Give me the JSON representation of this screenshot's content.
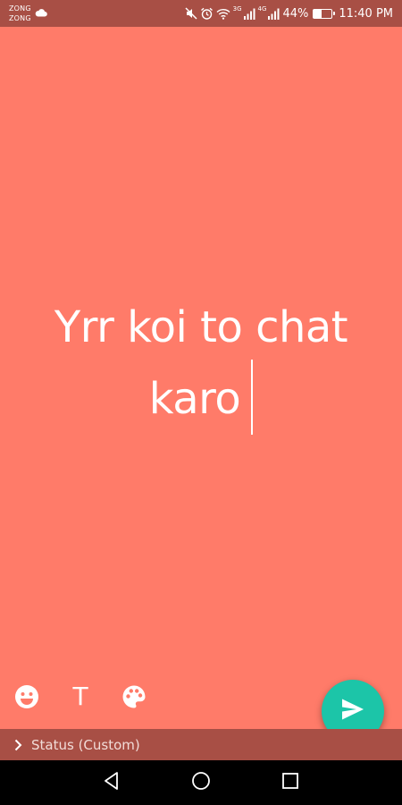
{
  "status_bar": {
    "carrier_1": "ZONG",
    "carrier_2": "ZONG",
    "network_1": "3G",
    "network_2": "4G",
    "battery_percent": "44%",
    "battery_level": 0.44,
    "time": "11:40 PM",
    "icons": [
      "cloud-icon",
      "mute-icon",
      "alarm-icon",
      "wifi-icon",
      "signal-icon",
      "battery-icon"
    ]
  },
  "composer": {
    "line_1": "Yrr koi to chat",
    "line_2": "karo",
    "background_color": "#ff7b69"
  },
  "toolbar": {
    "emoji_icon": "emoji-icon",
    "text_label": "T",
    "palette_icon": "palette-icon",
    "send_icon": "send-icon",
    "send_color": "#1cc5a8"
  },
  "privacy": {
    "label": "Status (Custom)"
  },
  "nav": {
    "back_icon": "back-triangle-icon",
    "home_icon": "home-circle-icon",
    "recents_icon": "recents-square-icon"
  }
}
